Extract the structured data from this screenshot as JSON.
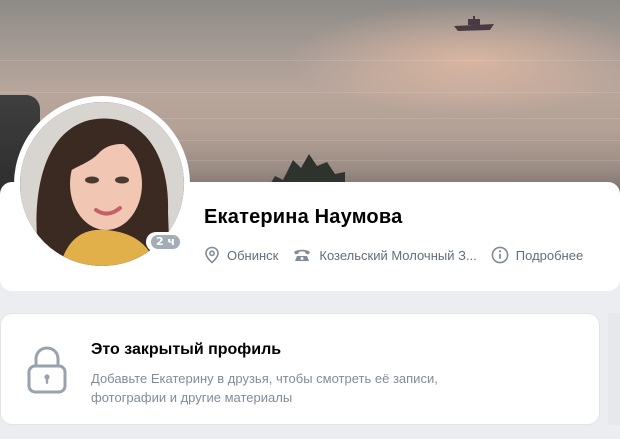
{
  "profile": {
    "name": "Екатерина Наумова",
    "online_badge": "2 ч",
    "city": "Обнинск",
    "work": "Козельский Молочный З...",
    "details_label": "Подробнее"
  },
  "closed_profile": {
    "title": "Это закрытый профиль",
    "line1": "Добавьте Екатерину в друзья, чтобы смотреть её записи,",
    "line2": "фотографии и другие материалы"
  },
  "colors": {
    "background": "#ebedf0",
    "secondary_text": "#626d7a",
    "muted_text": "#818c99",
    "badge": "#a3adb8"
  },
  "icons": {
    "city": "location-pin-icon",
    "work": "phone-icon",
    "details": "info-icon",
    "closed": "lock-icon"
  }
}
